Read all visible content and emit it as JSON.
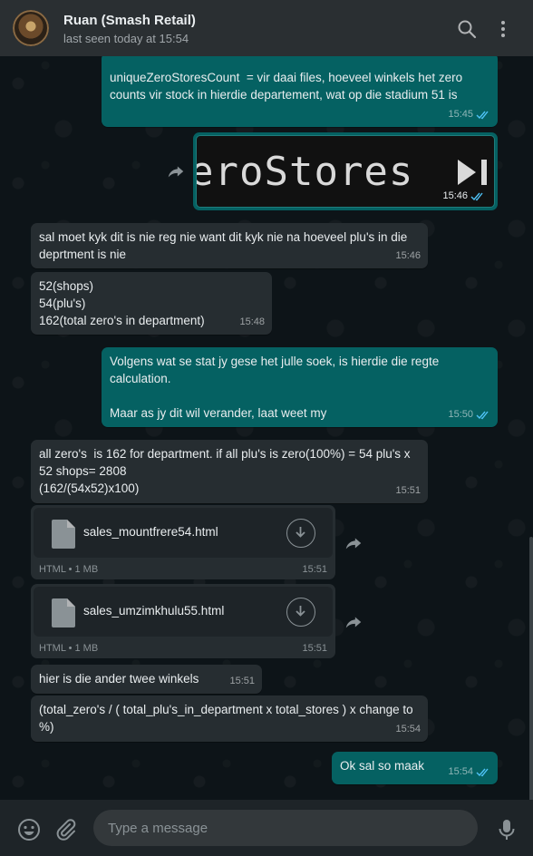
{
  "header": {
    "contact_name": "Ruan (Smash Retail)",
    "status": "last seen today at 15:54"
  },
  "messages": [
    {
      "dir": "out",
      "text": "uniqueZeroStoresCount  = vir daai files, hoeveel winkels het zero counts vir stock in hierdie departement, wat op die stadium 51 is",
      "time": "15:45",
      "status": "read"
    },
    {
      "dir": "out",
      "type": "image",
      "image_text": "eroStores",
      "time": "15:46",
      "status": "read"
    },
    {
      "dir": "in",
      "text": "sal moet kyk dit is nie reg nie want dit kyk nie na hoeveel plu's in die deprtment is nie",
      "time": "15:46"
    },
    {
      "dir": "in",
      "text": "52(shops)\n54(plu's)\n162(total zero's in department)",
      "time": "15:48"
    },
    {
      "dir": "out",
      "text": "Volgens wat se stat jy gese het julle soek, is hierdie die regte calculation.\n\nMaar as jy dit wil verander, laat weet my",
      "time": "15:50",
      "status": "read"
    },
    {
      "dir": "in",
      "text": "all zero's  is 162 for department. if all plu's is zero(100%) = 54 plu's x 52 shops= 2808\n(162/(54x52)x100)",
      "time": "15:51"
    },
    {
      "dir": "in",
      "type": "file",
      "file_name": "sales_mountfrere54.html",
      "file_type": "HTML • 1 MB",
      "time": "15:51"
    },
    {
      "dir": "in",
      "type": "file",
      "file_name": "sales_umzimkhulu55.html",
      "file_type": "HTML • 1 MB",
      "time": "15:51"
    },
    {
      "dir": "in",
      "text": "hier is die ander twee winkels",
      "time": "15:51"
    },
    {
      "dir": "in",
      "text": "(total_zero's / ( total_plu's_in_department x total_stores ) x change to %)",
      "time": "15:54"
    },
    {
      "dir": "out",
      "text": "Ok sal so maak",
      "time": "15:54",
      "status": "read"
    }
  ],
  "composer": {
    "placeholder": "Type a message"
  },
  "colors": {
    "header_bg": "#2a2f32",
    "chat_bg": "#0d1418",
    "incoming_bubble": "#262d31",
    "outgoing_bubble": "#056162",
    "read_tick": "#4fc3f7"
  }
}
